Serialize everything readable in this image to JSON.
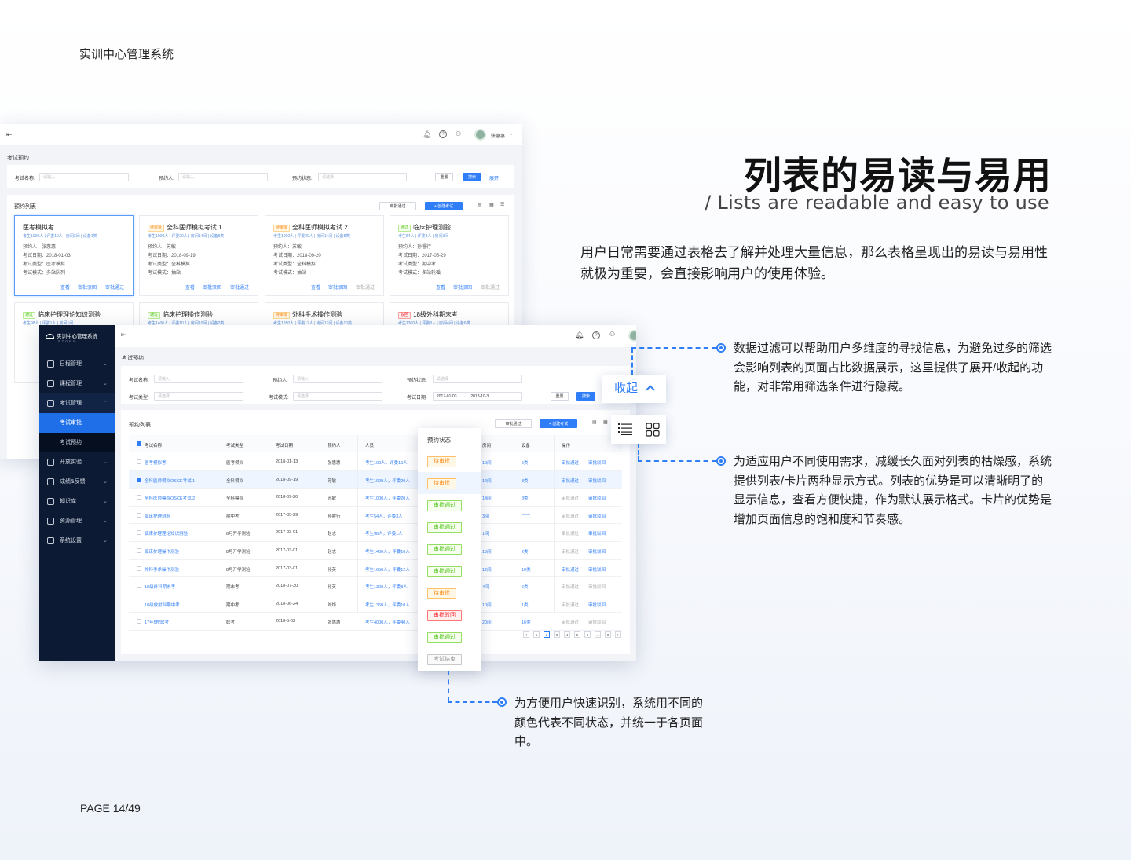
{
  "header": {
    "system_title": "实训中心管理系统"
  },
  "footer": {
    "page": "PAGE 14/49"
  },
  "hero": {
    "title": "列表的易读与易用",
    "subtitle": "/  Lists are readable and easy to use",
    "description": "用户日常需要通过表格去了解并处理大量信息，那么表格呈现出的易读与易用性就极为重要，会直接影响用户的使用体验。"
  },
  "notes": {
    "filter": "数据过滤可以帮助用户多维度的寻找信息，为避免过多的筛选会影响列表的页面占比数据展示，这里提供了展开/收起的功能，对非常用筛选条件进行隐藏。",
    "views": "为适应用户不同使用需求，减缓长久面对列表的枯燥感，系统提供列表/卡片两种显示方式。列表的优势是可以清晰明了的显示信息，查看方便快捷，作为默认展示格式。卡片的优势是增加页面信息的饱和度和节奏感。",
    "status": "为方便用户快速识别，系统用不同的颜色代表不同状态，并统一于各页面中。"
  },
  "colors": {
    "accent": "#2f7df7",
    "sidebar": "#0c1a33",
    "pending": "#fa8c16",
    "approved": "#52c41a",
    "rejected": "#f5222d"
  },
  "widgets": {
    "collapse_label": "收起",
    "collapse_icon": "chevron-up-icon",
    "list_view_icon": "list-icon",
    "card_view_icon": "grid-icon"
  },
  "app": {
    "logo_title": "实训中心管理系统",
    "logo_sub": "S.T.O.R.M.",
    "user": "张惠惠",
    "page_title": "考试预约",
    "list_title": "预约列表",
    "filters": {
      "name_label": "考试名称:",
      "name_ph": "请输入",
      "booker_label": "预约人:",
      "booker_ph": "请输入",
      "status_label": "预约状态:",
      "status_ph": "请选择",
      "type_label": "考试类型:",
      "type_ph": "请选择",
      "mode_label": "考试模式:",
      "mode_ph": "请选择",
      "date_label": "考试日期:",
      "date_from": "2017-01-03",
      "date_sep": "→",
      "date_to": "2018-10-3",
      "reset": "重置",
      "search": "搜索",
      "expand": "展开"
    },
    "actions": {
      "batch_approve": "审批通过",
      "create": "+ 创建考试"
    },
    "sidebar": [
      {
        "label": "日程管理",
        "icon": "calendar-icon"
      },
      {
        "label": "课程管理",
        "icon": "book-icon"
      },
      {
        "label": "考试管理",
        "icon": "exam-icon"
      },
      {
        "label": "开放实验",
        "icon": "flask-icon"
      },
      {
        "label": "成绩&反馈",
        "icon": "score-icon"
      },
      {
        "label": "知识库",
        "icon": "library-icon"
      },
      {
        "label": "资源管理",
        "icon": "resource-icon"
      },
      {
        "label": "系统设置",
        "icon": "settings-icon"
      }
    ],
    "sidebar_sub": [
      "考试审批",
      "考试预约"
    ],
    "columns": [
      "考试名称",
      "考试类型",
      "考试日期",
      "预约人",
      "人员",
      "预约状态",
      "房间",
      "设备",
      "操作"
    ],
    "rows": [
      {
        "name": "医考模拟考",
        "type": "医考模拟",
        "date": "2018-01-13",
        "booker": "张惠惠",
        "people": "考生100人，评委10人",
        "room": "10间",
        "device": "5类",
        "status": "待审批",
        "status_color": "orange"
      },
      {
        "name": "全科医师模拟OSCE考试 1",
        "type": "全科模拟",
        "date": "2018-09-19",
        "booker": "苏敏",
        "people": "考生1000人，评委20人",
        "room": "14间",
        "device": "8类",
        "status": "待审批",
        "status_color": "orange"
      },
      {
        "name": "全科医师模拟OSCE考试 2",
        "type": "全科模拟",
        "date": "2018-09-20",
        "booker": "苏敏",
        "people": "考生1000人，评委20人",
        "room": "14间",
        "device": "8类",
        "status": "审批通过",
        "status_color": "green"
      },
      {
        "name": "临床护理测验",
        "type": "期中考",
        "date": "2017-05-29",
        "booker": "孙睿行",
        "people": "考生54人，评委3人",
        "room": "3间",
        "device": "——",
        "status": "审批通过",
        "status_color": "green"
      },
      {
        "name": "临床护理理论知识测验",
        "type": "8月开学测验",
        "date": "2017-03-01",
        "booker": "赵志",
        "people": "考生98人，评委1人",
        "room": "1间",
        "device": "——",
        "status": "审批通过",
        "status_color": "green"
      },
      {
        "name": "临床护理操作测验",
        "type": "8月开学测验",
        "date": "2017-03-01",
        "booker": "赵志",
        "people": "考生1400人，评委10人",
        "room": "10间",
        "device": "2类",
        "status": "审批通过",
        "status_color": "green"
      },
      {
        "name": "外科手术操作测验",
        "type": "8月开学测验",
        "date": "2017-03-01",
        "booker": "孙英",
        "people": "考生1650人，评委12人",
        "room": "12间",
        "device": "10类",
        "status": "待审批",
        "status_color": "orange"
      },
      {
        "name": "18级外科期末考",
        "type": "期末考",
        "date": "2018-07-30",
        "booker": "孙英",
        "people": "考生1300人，评委8人",
        "room": "4间",
        "device": "6类",
        "status": "审批驳回",
        "status_color": "red"
      },
      {
        "name": "18级放射科期中考",
        "type": "期中考",
        "date": "2018-06-24",
        "booker": "刘烨",
        "people": "考生1360人，评委10人",
        "room": "10间",
        "device": "1类",
        "status": "审批通过",
        "status_color": "green"
      },
      {
        "name": "17年5校联考",
        "type": "联考",
        "date": "2018-5-02",
        "booker": "张惠惠",
        "people": "考生4000人，评委40人",
        "room": "20间",
        "device": "16类",
        "status": "考试结束",
        "status_color": "grey"
      }
    ],
    "row_actions": {
      "approve": "审批通过",
      "reject": "审批驳回"
    },
    "pager": [
      "<",
      "1",
      "2",
      "3",
      "4",
      "5",
      "6",
      "...",
      "8",
      ">"
    ],
    "cards": [
      {
        "title": "医考模拟考",
        "tag": "",
        "meta": "考生1000人 | 评委10人 | 房间2间 | 设备1类",
        "booker": "预约人：张惠惠",
        "date": "考试日期：2018-01-03",
        "type": "考试类型：医考模拟",
        "mode": "考试模式：多站队列"
      },
      {
        "title": "全科医师模拟考试 1",
        "tag": "待审批",
        "meta": "考生1000人 | 评委20人 | 房间14间 | 设备8类",
        "booker": "预约人：苏敏",
        "date": "考试日期：2018-09-19",
        "type": "考试类型：全科模拟",
        "mode": "考试模式：抽站"
      },
      {
        "title": "全科医师模拟考试 2",
        "tag": "待审批",
        "meta": "考生1000人 | 评委20人 | 房间14间 | 设备8类",
        "booker": "预约人：苏敏",
        "date": "考试日期：2018-09-20",
        "type": "考试类型：全科模拟",
        "mode": "考试模式：抽站"
      },
      {
        "title": "临床护理测验",
        "tag": "通过",
        "meta": "考生54人 | 评委3人 | 房间3间",
        "booker": "预约人：孙睿行",
        "date": "考试日期：2017-05-29",
        "type": "考试类型：期中考",
        "mode": "考试模式：多站轮循"
      },
      {
        "title": "临床护理理论知识测验",
        "tag": "通过",
        "meta": "考生98人 | 评委1人 | 房间1间"
      },
      {
        "title": "临床护理操作测验",
        "tag": "通过",
        "meta": "考生1400人 | 评委10人 | 房间10间 | 设备2类"
      },
      {
        "title": "外科手术操作测验",
        "tag": "待审批",
        "meta": "考生1650人 | 评委12人 | 房间12间 | 设备10类"
      },
      {
        "title": "18级外科期末考",
        "tag": "驳回",
        "meta": "考生1300人 | 评委8人 | 房间4间 | 设备6类"
      }
    ],
    "card_actions": {
      "view": "查看",
      "reject": "审批驳回",
      "approve": "审批通过"
    }
  }
}
